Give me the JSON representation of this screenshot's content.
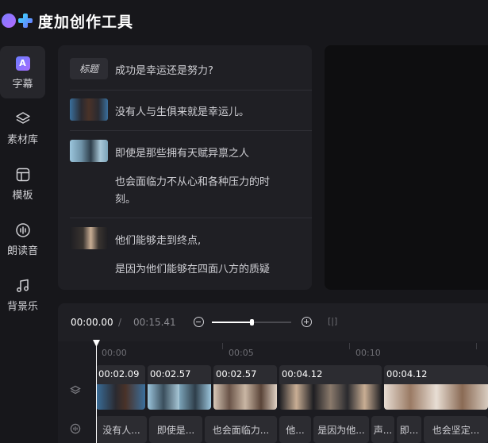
{
  "app": {
    "title": "度加创作工具"
  },
  "sidebar": {
    "items": [
      {
        "label": "字幕",
        "icon": "subtitle-icon",
        "active": true
      },
      {
        "label": "素材库",
        "icon": "layers-icon",
        "active": false
      },
      {
        "label": "模板",
        "icon": "template-icon",
        "active": false
      },
      {
        "label": "朗读音",
        "icon": "voice-icon",
        "active": false
      },
      {
        "label": "背景乐",
        "icon": "music-icon",
        "active": false
      }
    ]
  },
  "script": {
    "title_tag": "标题",
    "title_text": "成功是幸运还是努力?",
    "lines": [
      "没有人与生俱来就是幸运儿。",
      "即使是那些拥有天赋异禀之人",
      "也会面临力不从心和各种压力的时",
      "刻。",
      "他们能够走到终点,",
      "是因为他们能够在四面八方的质疑"
    ]
  },
  "timeline": {
    "current_time": "00:00.00",
    "separator": "/",
    "total_time": "00:15.41",
    "zoom_level": 0.5,
    "fit_icon": "[|]",
    "ruler": [
      "00:00",
      "00:05",
      "00:10"
    ],
    "clips": [
      {
        "duration": "00:02.09"
      },
      {
        "duration": "00:02.57"
      },
      {
        "duration": "00:02.57"
      },
      {
        "duration": "00:04.12"
      },
      {
        "duration": "00:04.12"
      }
    ],
    "subtitles": [
      "没有人...",
      "即使是...",
      "也会面临力...",
      "他...",
      "是因为他...",
      "声...",
      "即...",
      "也会坚定..."
    ]
  },
  "colors": {
    "accent": "#6b7dff",
    "background": "#17171b",
    "panel": "#1f1f24"
  }
}
